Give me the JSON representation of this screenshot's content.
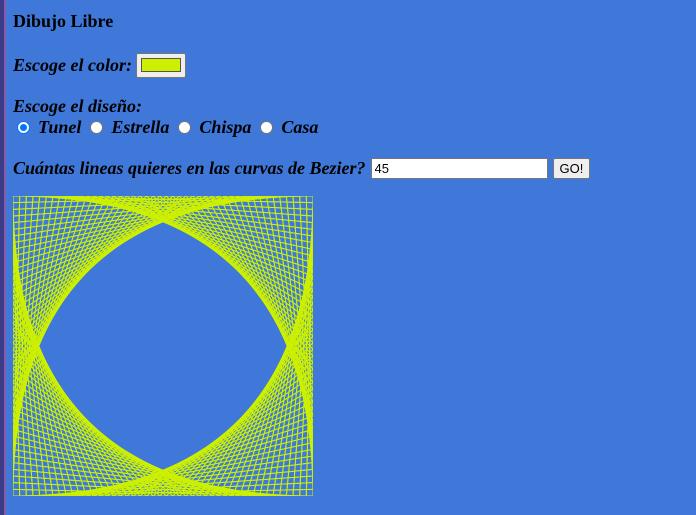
{
  "page": {
    "title": "Dibujo Libre",
    "color_label": "Escoge el color:",
    "selected_color": "#ccf000",
    "background_color": "#3f78d9",
    "design_label": "Escoge el diseño:",
    "design_options": [
      {
        "label": "Tunel",
        "checked": true
      },
      {
        "label": "Estrella",
        "checked": false
      },
      {
        "label": "Chispa",
        "checked": false
      },
      {
        "label": "Casa",
        "checked": false
      }
    ],
    "bezier_label": "Cuántas lineas quieres en las curvas de Bezier?",
    "lines_value": "45",
    "go_label": "GO!"
  },
  "drawing": {
    "design": "Tunel",
    "lines": 45,
    "color": "#ccf000"
  }
}
